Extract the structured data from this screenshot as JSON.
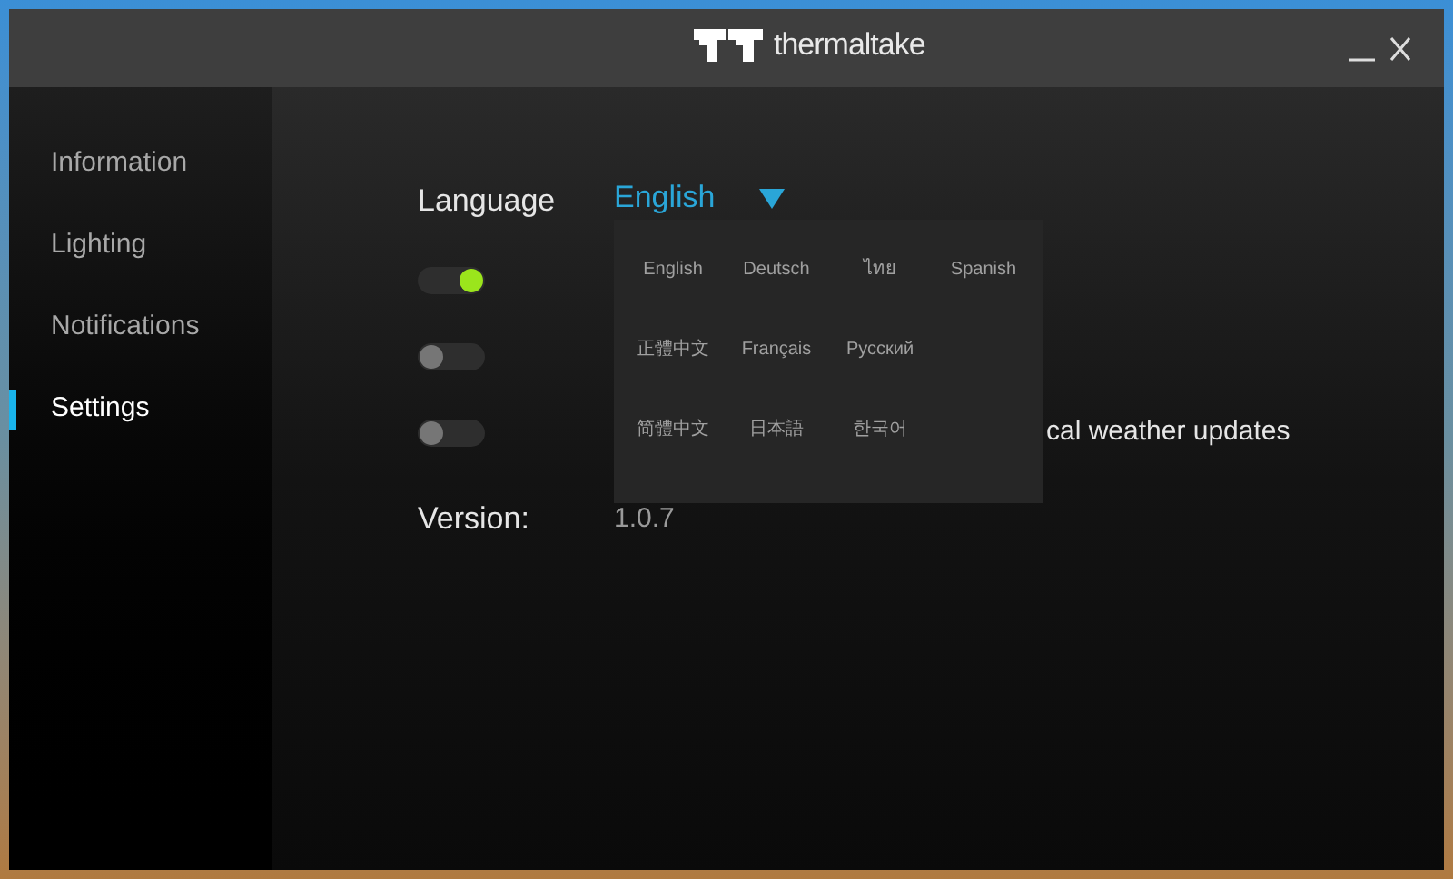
{
  "window": {
    "title": "thermaltake"
  },
  "sidebar": {
    "items": [
      {
        "label": "Information",
        "selected": false
      },
      {
        "label": "Lighting",
        "selected": false
      },
      {
        "label": "Notifications",
        "selected": false
      },
      {
        "label": "Settings",
        "selected": true
      }
    ]
  },
  "language": {
    "label": "Language",
    "value": "English",
    "expanded": true,
    "option_rows": [
      {
        "options": [
          {
            "label": "English"
          },
          {
            "label": "Deutsch"
          },
          {
            "label": "ไทย"
          },
          {
            "label": "Spanish"
          }
        ]
      },
      {
        "options": [
          {
            "label": "正體中文"
          },
          {
            "label": "Français"
          },
          {
            "label": "Русский"
          }
        ]
      },
      {
        "options": [
          {
            "label": "简體中文"
          },
          {
            "label": "日本語"
          },
          {
            "label": "한국어"
          }
        ]
      }
    ]
  },
  "toggles": [
    {
      "on": true
    },
    {
      "on": false
    },
    {
      "on": false,
      "label": "cal weather updates"
    }
  ],
  "version": {
    "label": "Version:",
    "value": "1.0.7"
  }
}
